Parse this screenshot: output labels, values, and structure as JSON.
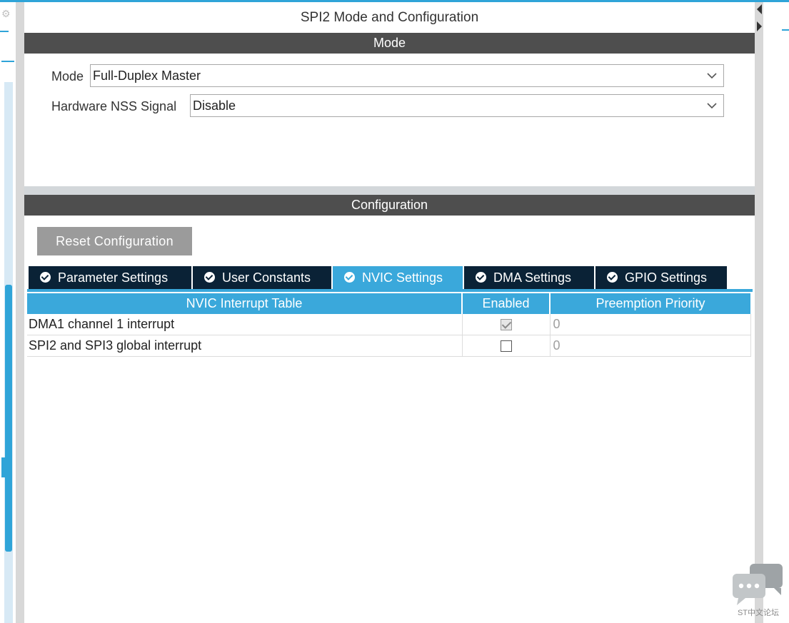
{
  "panel": {
    "title": "SPI2 Mode and Configuration"
  },
  "mode_section": {
    "header": "Mode",
    "mode": {
      "label": "Mode",
      "value": "Full-Duplex Master"
    },
    "nss": {
      "label": "Hardware NSS Signal",
      "value": "Disable"
    }
  },
  "config_section": {
    "header": "Configuration",
    "reset_button": "Reset Configuration",
    "tabs": [
      {
        "label": "Parameter Settings",
        "active": false
      },
      {
        "label": "User Constants",
        "active": false
      },
      {
        "label": "NVIC Settings",
        "active": true
      },
      {
        "label": "DMA Settings",
        "active": false
      },
      {
        "label": "GPIO Settings",
        "active": false
      }
    ]
  },
  "nvic_table": {
    "headers": [
      "NVIC Interrupt Table",
      "Enabled",
      "Preemption Priority"
    ],
    "rows": [
      {
        "name": "DMA1 channel 1 interrupt",
        "enabled": true,
        "priority": "0"
      },
      {
        "name": "SPI2 and SPI3 global interrupt",
        "enabled": false,
        "priority": "0"
      }
    ]
  },
  "watermark": "ST中文论坛",
  "colors": {
    "accent": "#3aa8db",
    "section_header": "#4e4e4e",
    "tab_inactive": "#0a2236",
    "reset_button": "#9b9b9b"
  },
  "icons": [
    "check-circle-icon",
    "chevron-down-icon",
    "collapse-arrow-icon",
    "chat-bubble-icon"
  ]
}
